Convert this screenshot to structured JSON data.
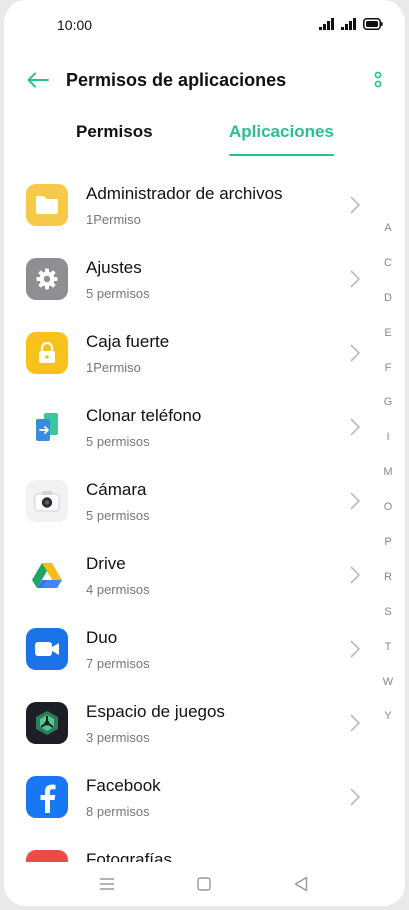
{
  "status_bar": {
    "time": "10:00"
  },
  "header": {
    "title": "Permisos de aplicaciones"
  },
  "tabs": [
    {
      "label": "Permisos"
    },
    {
      "label": "Aplicaciones"
    }
  ],
  "apps": [
    {
      "name": "Administrador de archivos",
      "permissions": "1Permiso",
      "icon": "folder-icon"
    },
    {
      "name": "Ajustes",
      "permissions": "5 permisos",
      "icon": "gear-icon"
    },
    {
      "name": "Caja fuerte",
      "permissions": "1Permiso",
      "icon": "lock-icon"
    },
    {
      "name": "Clonar teléfono",
      "permissions": "5 permisos",
      "icon": "phone-clone-icon"
    },
    {
      "name": "Cámara",
      "permissions": "5 permisos",
      "icon": "camera-icon"
    },
    {
      "name": "Drive",
      "permissions": "4 permisos",
      "icon": "drive-icon"
    },
    {
      "name": "Duo",
      "permissions": "7 permisos",
      "icon": "video-camera-icon"
    },
    {
      "name": "Espacio de juegos",
      "permissions": "3 permisos",
      "icon": "game-space-icon"
    },
    {
      "name": "Facebook",
      "permissions": "8 permisos",
      "icon": "facebook-icon"
    },
    {
      "name": "Fotografías",
      "permissions": "",
      "icon": "photos-icon"
    }
  ],
  "alpha_index": [
    "A",
    "C",
    "D",
    "E",
    "F",
    "G",
    "I",
    "M",
    "O",
    "P",
    "R",
    "S",
    "T",
    "W",
    "Y"
  ],
  "colors": {
    "accent": "#2bbf8e",
    "text": "#111111",
    "secondary": "#777777"
  }
}
